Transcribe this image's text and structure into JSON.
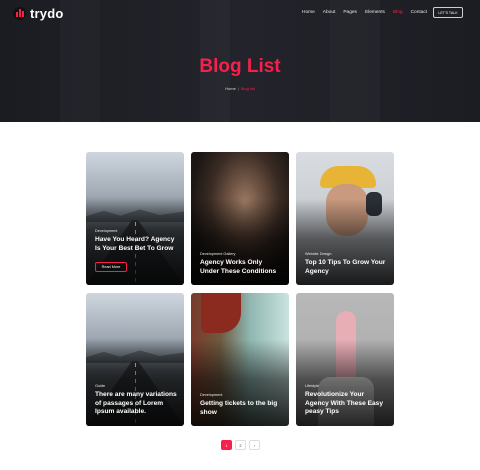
{
  "brand": {
    "name": "trydo",
    "accent": "#f81f4b"
  },
  "nav": {
    "items": [
      {
        "label": "Home",
        "active": false
      },
      {
        "label": "About",
        "active": false
      },
      {
        "label": "Pages",
        "active": false
      },
      {
        "label": "Elements",
        "active": false
      },
      {
        "label": "Blog",
        "active": true
      },
      {
        "label": "Contact",
        "active": false
      }
    ],
    "cta_label": "LET'S TALK"
  },
  "hero": {
    "title": "Blog List",
    "breadcrumb": {
      "home": "Home",
      "current": "Blog list"
    }
  },
  "posts": [
    {
      "category": "Development",
      "title": "Have You Heard? Agency Is Your Best Bet To Grow",
      "button": "Read More",
      "image": "road"
    },
    {
      "category": "Development Gallery",
      "title": "Agency Works Only Under These Conditions",
      "image": "man-with-glasses"
    },
    {
      "category": "Website Design",
      "title": "Top 10 Tips To Grow Your Agency",
      "image": "man-with-cap-and-headphones"
    },
    {
      "category": "Guide",
      "title": "There are many variations of passages of Lorem Ipsum available.",
      "image": "road"
    },
    {
      "category": "Development",
      "title": "Getting tickets to the big show",
      "image": "man-with-beanie"
    },
    {
      "category": "Lifestyle",
      "title": "Revolutionize Your Agency With These Easy peasy Tips",
      "image": "person-holding-skateboard"
    }
  ],
  "pagination": {
    "pages": [
      "1",
      "2"
    ],
    "current": "1",
    "next_icon": "chevron-right-icon",
    "next_label": "›"
  }
}
